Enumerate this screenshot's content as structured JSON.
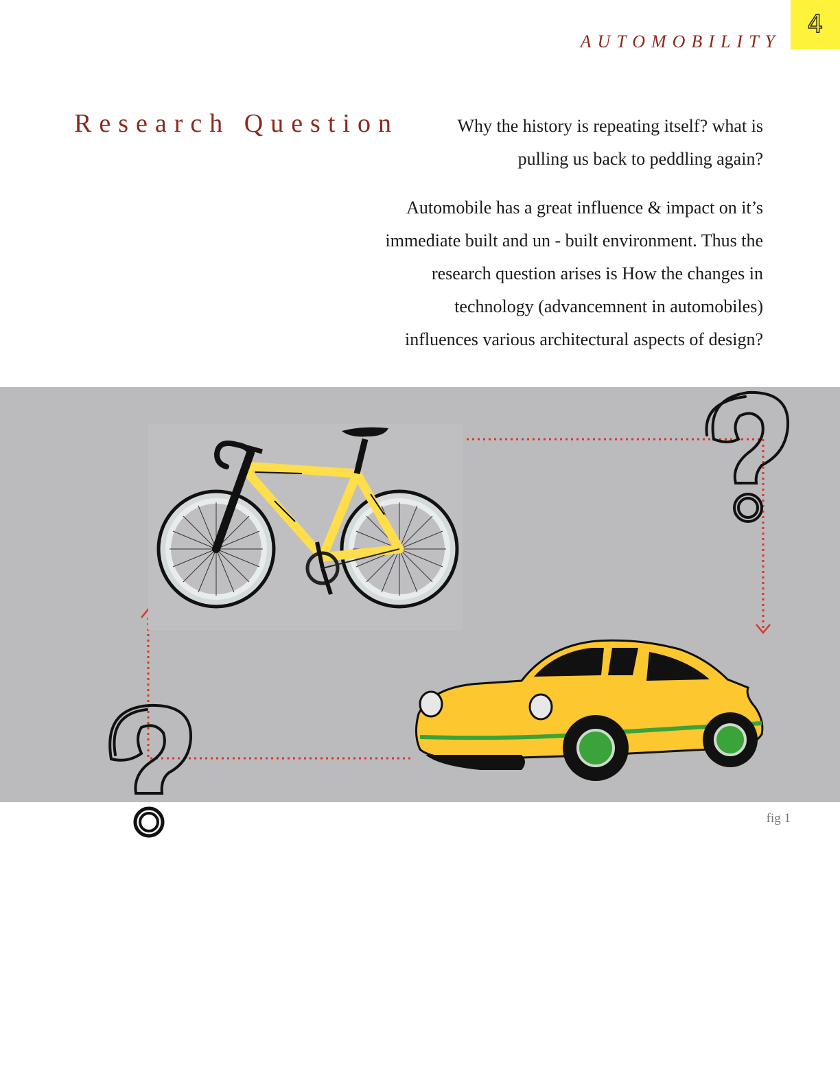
{
  "header": {
    "running_title": "AUTOMOBILITY",
    "page_number": "4"
  },
  "section": {
    "title": "Research Question",
    "question": "Why the history is repeating itself? what is pulling us back to peddling again?",
    "paragraph": "Automobile has a great influence & impact on it’s immediate built and un - built environment. Thus the research question arises is How the changes in technology (advancemnent in automobiles) influences various architectural aspects of design?"
  },
  "figure": {
    "caption": "fig 1",
    "illustrations": [
      "bicycle-illustration",
      "car-illustration",
      "question-mark-icon",
      "question-mark-icon"
    ],
    "colors": {
      "band": "#bbbbbd",
      "accent_yellow": "#fdc72f",
      "bike_yellow": "#fede4a",
      "arrow_red": "#d9362b",
      "stripe_green": "#3aa33a"
    }
  },
  "colors": {
    "title": "#8a2a1c",
    "page_tab": "#fff23a"
  }
}
